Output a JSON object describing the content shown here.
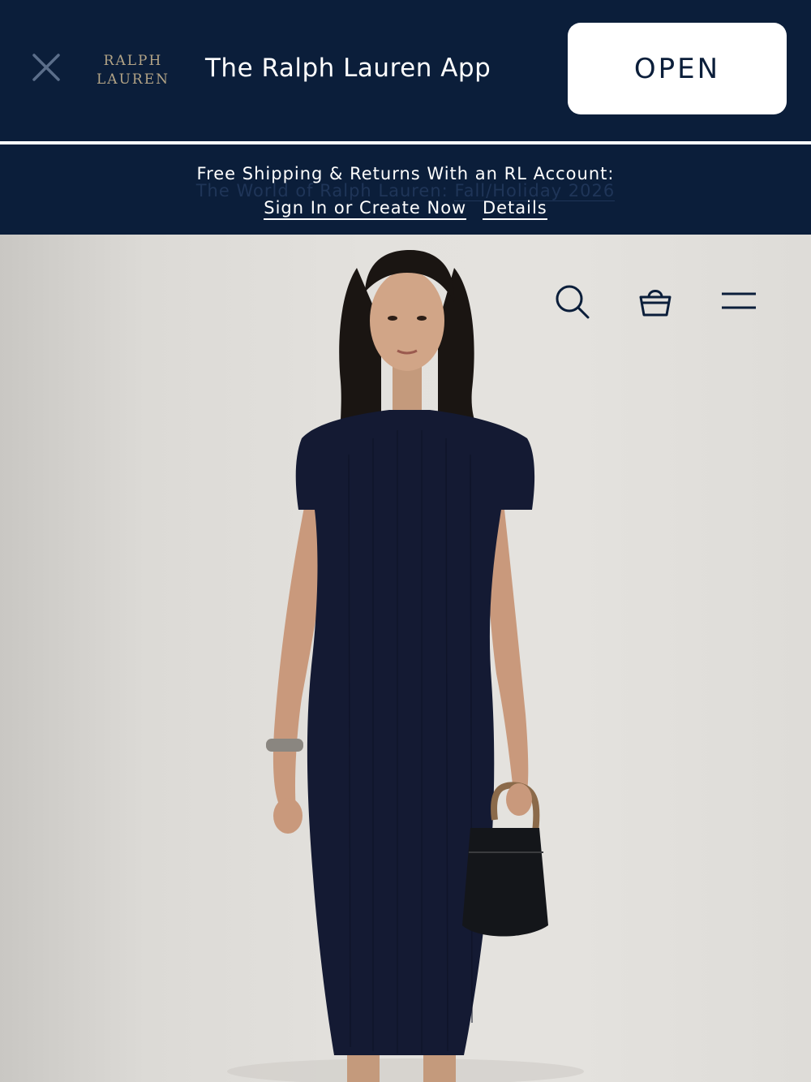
{
  "app_banner": {
    "brand_line1": "RALPH",
    "brand_line2": "LAUREN",
    "title": "The Ralph Lauren App",
    "open_label": "OPEN"
  },
  "promo": {
    "text": "Free Shipping & Returns With an RL Account:",
    "ghost_text_prefix": "The World of Ralph Lauren:",
    "ghost_text_link": "Fall/Holiday 2026",
    "sign_in_label": "Sign In or Create Now",
    "details_label": "Details"
  },
  "header": {
    "icons": [
      "search-icon",
      "shopping-bag-icon",
      "menu-icon"
    ]
  },
  "colors": {
    "navy": "#0b1e3a",
    "gold": "#b3a486",
    "white": "#ffffff",
    "hero_bg": "#e3e1dd",
    "dress": "#141a33"
  }
}
